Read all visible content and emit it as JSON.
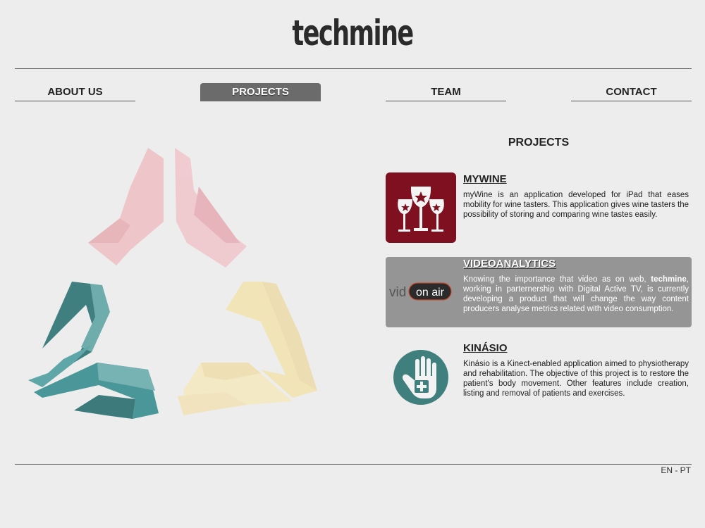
{
  "brand": {
    "name": "techmine"
  },
  "nav": {
    "about": "ABOUT US",
    "projects": "PROJECTS",
    "team": "TEAM",
    "contact": "CONTACT",
    "active": "projects"
  },
  "projects_section": {
    "title": "PROJECTS",
    "items": [
      {
        "name": "MYWINE",
        "description": "myWine is an application developed for iPad that eases mobility for wine tasters. This application gives wine tasters the possibility of storing and comparing wine tastes easily.",
        "icon": "wine-glasses-icon",
        "thumb_color": "#7e1020"
      },
      {
        "name": "VIDEOANALYTICS",
        "description_pre": "Knowing the importance that video as on web, ",
        "description_bold": "techmine",
        "description_post": ", working in parternership with Digital Active TV, is currently developing a product that will change the way content producers analyse metrics related with video consumption.",
        "icon": "on-air-icon",
        "thumb_text_left": "vid",
        "thumb_text_badge": "on air"
      },
      {
        "name": "KINÁSIO",
        "description": "Kinásio is a Kinect-enabled application aimed to physiotherapy and rehabilitation. The objective of this project is to restore the patient's body movement. Other features include creation, listing and removal of patients and exercises.",
        "icon": "hand-plus-icon",
        "thumb_color": "#3f7f7d"
      }
    ]
  },
  "footer": {
    "lang_en": "EN",
    "lang_sep": " - ",
    "lang_pt": "PT"
  },
  "colors": {
    "background": "#ededed",
    "emblem_pink": "#eec8cc",
    "emblem_teal": "#4e9a9b",
    "emblem_yellow": "#f2e6bd"
  }
}
